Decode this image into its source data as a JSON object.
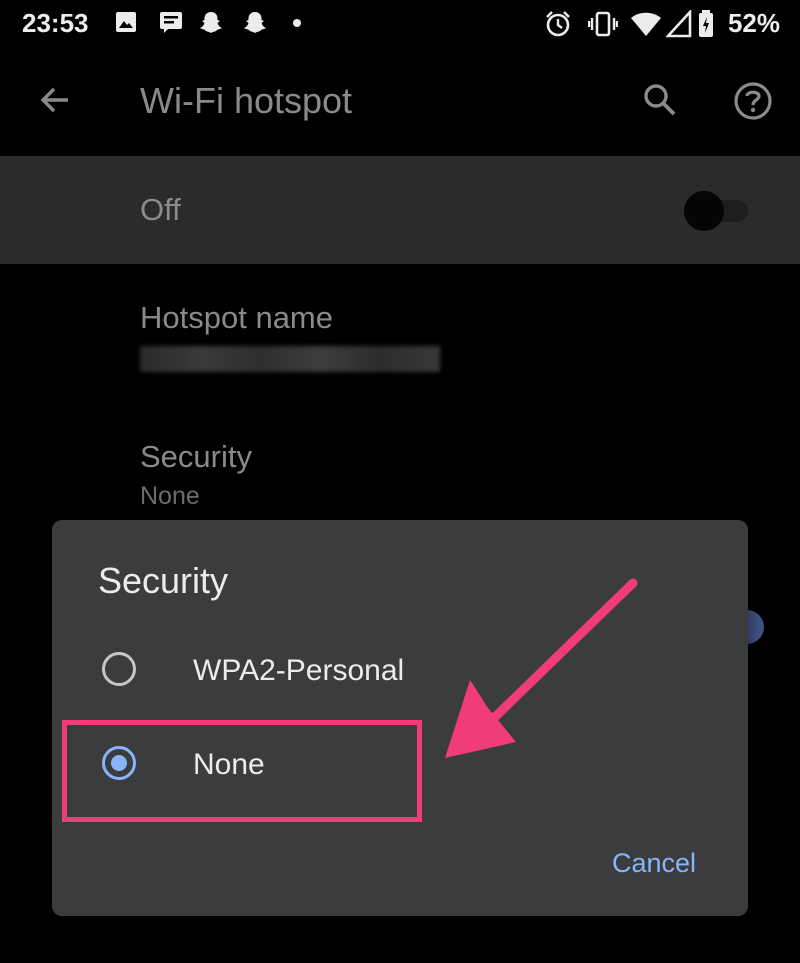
{
  "status_bar": {
    "time": "23:53",
    "battery": "52%",
    "left_icons": [
      "image-icon",
      "message-icon",
      "snapchat-icon",
      "snapchat-icon",
      "dot-icon"
    ],
    "right_icons": [
      "alarm-icon",
      "vibrate-icon",
      "wifi-icon",
      "signal-icon",
      "battery-icon"
    ]
  },
  "app_bar": {
    "title": "Wi-Fi hotspot",
    "back_icon": "back-arrow-icon",
    "search_icon": "search-icon",
    "help_icon": "help-icon"
  },
  "main_toggle": {
    "label": "Off",
    "state": false
  },
  "settings": {
    "hotspot_name": {
      "title": "Hotspot name",
      "value_blurred": true
    },
    "security": {
      "title": "Security",
      "summary": "None"
    }
  },
  "dialog": {
    "title": "Security",
    "options": [
      {
        "label": "WPA2-Personal",
        "selected": false
      },
      {
        "label": "None",
        "selected": true
      }
    ],
    "cancel_label": "Cancel"
  },
  "annotation": {
    "highlight_color": "#f03c78",
    "arrow_color": "#f03c78"
  },
  "colors": {
    "accent": "#8ab4f8",
    "dialog_bg": "#3a3c3e",
    "background": "#000000"
  }
}
